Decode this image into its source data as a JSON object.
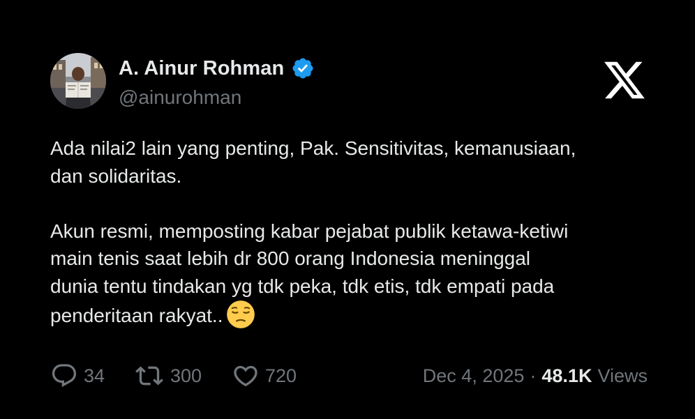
{
  "author": {
    "display_name": "A. Ainur Rohman",
    "handle": "@ainurohman",
    "verified": true
  },
  "brand": {
    "logo_icon": "x-logo-icon"
  },
  "tweet": {
    "lines": [
      "Ada nilai2 lain yang penting, Pak. Sensitivitas, kemanusiaan,",
      "dan solidaritas.",
      "",
      "Akun resmi, memposting kabar pejabat publik ketawa-ketiwi",
      "main tenis saat lebih dr 800 orang Indonesia meninggal",
      "dunia tentu tindakan yg tdk peka, tdk etis, tdk empati pada",
      "penderitaan rakyat.."
    ],
    "emoji": "pensive-face-icon"
  },
  "metrics": {
    "replies": "34",
    "reposts": "300",
    "likes": "720"
  },
  "meta": {
    "date": "Dec 4, 2025",
    "separator": "·",
    "views_count": "48.1K",
    "views_label": "Views"
  },
  "colors": {
    "background": "#000000",
    "text": "#e7e9ea",
    "secondary": "#71767b",
    "verified_badge": "#1d9bf0"
  }
}
